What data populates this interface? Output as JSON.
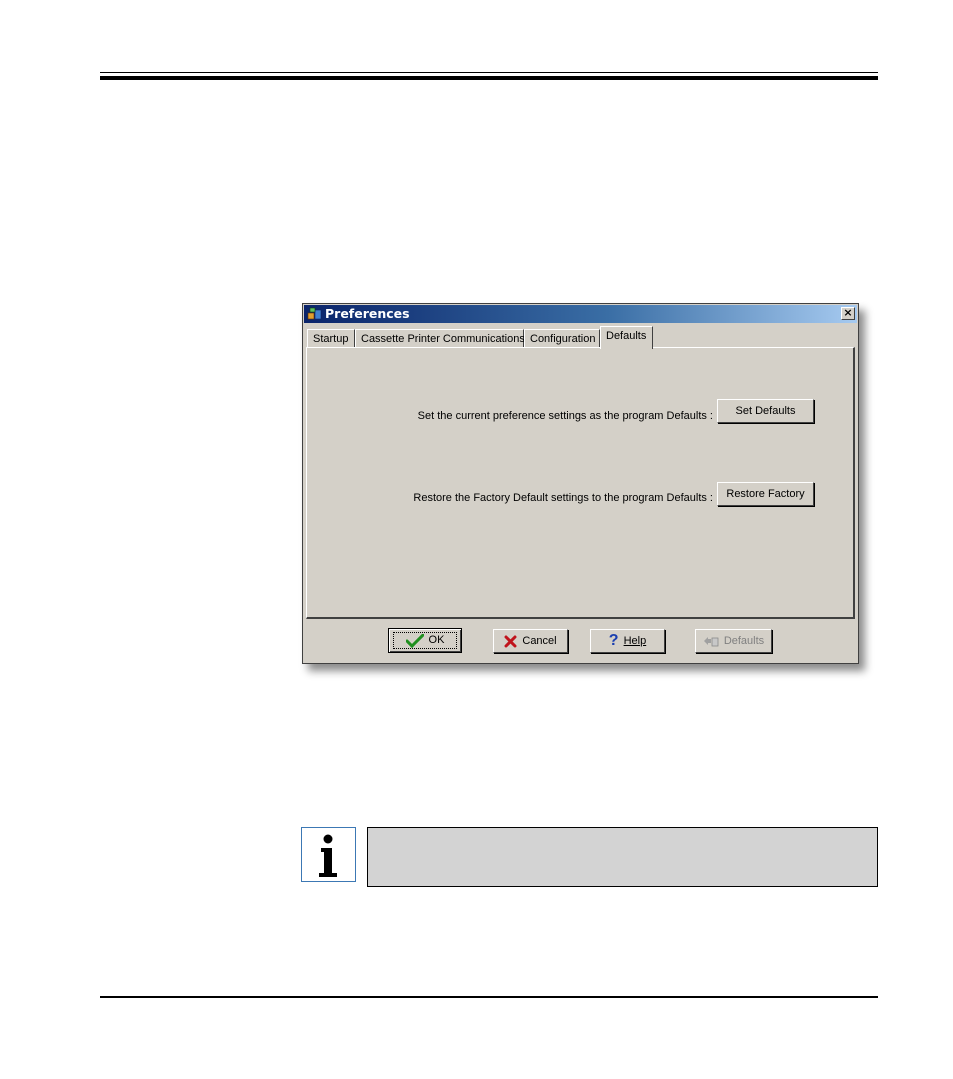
{
  "dialog": {
    "title": "Preferences",
    "close_label": "×",
    "tabs": [
      {
        "label": "Startup"
      },
      {
        "label": "Cassette Printer Communications"
      },
      {
        "label": "Configuration"
      },
      {
        "label": "Defaults"
      }
    ],
    "active_tab": "Defaults",
    "rows": [
      {
        "label": "Set the current preference settings as the program Defaults :",
        "button": "Set Defaults"
      },
      {
        "label": "Restore the Factory Default settings to the program Defaults :",
        "button": "Restore Factory"
      }
    ],
    "footer": {
      "ok_label": "OK",
      "cancel_label": "Cancel",
      "help_label": "Help",
      "defaults_label": "Defaults"
    }
  },
  "colors": {
    "dialog_bg": "#d4d0c8",
    "title_start": "#0a246a",
    "title_end": "#a6caf0",
    "ok_check": "#1f8f1f",
    "cancel_x": "#c0141c",
    "help_q": "#1a3fb0",
    "info_border": "#3c78b4"
  },
  "icons": {
    "title": "app-icon",
    "ok": "checkmark-icon",
    "cancel": "x-mark-icon",
    "help": "question-mark-icon",
    "defaults": "defaults-icon",
    "note": "info-icon"
  }
}
